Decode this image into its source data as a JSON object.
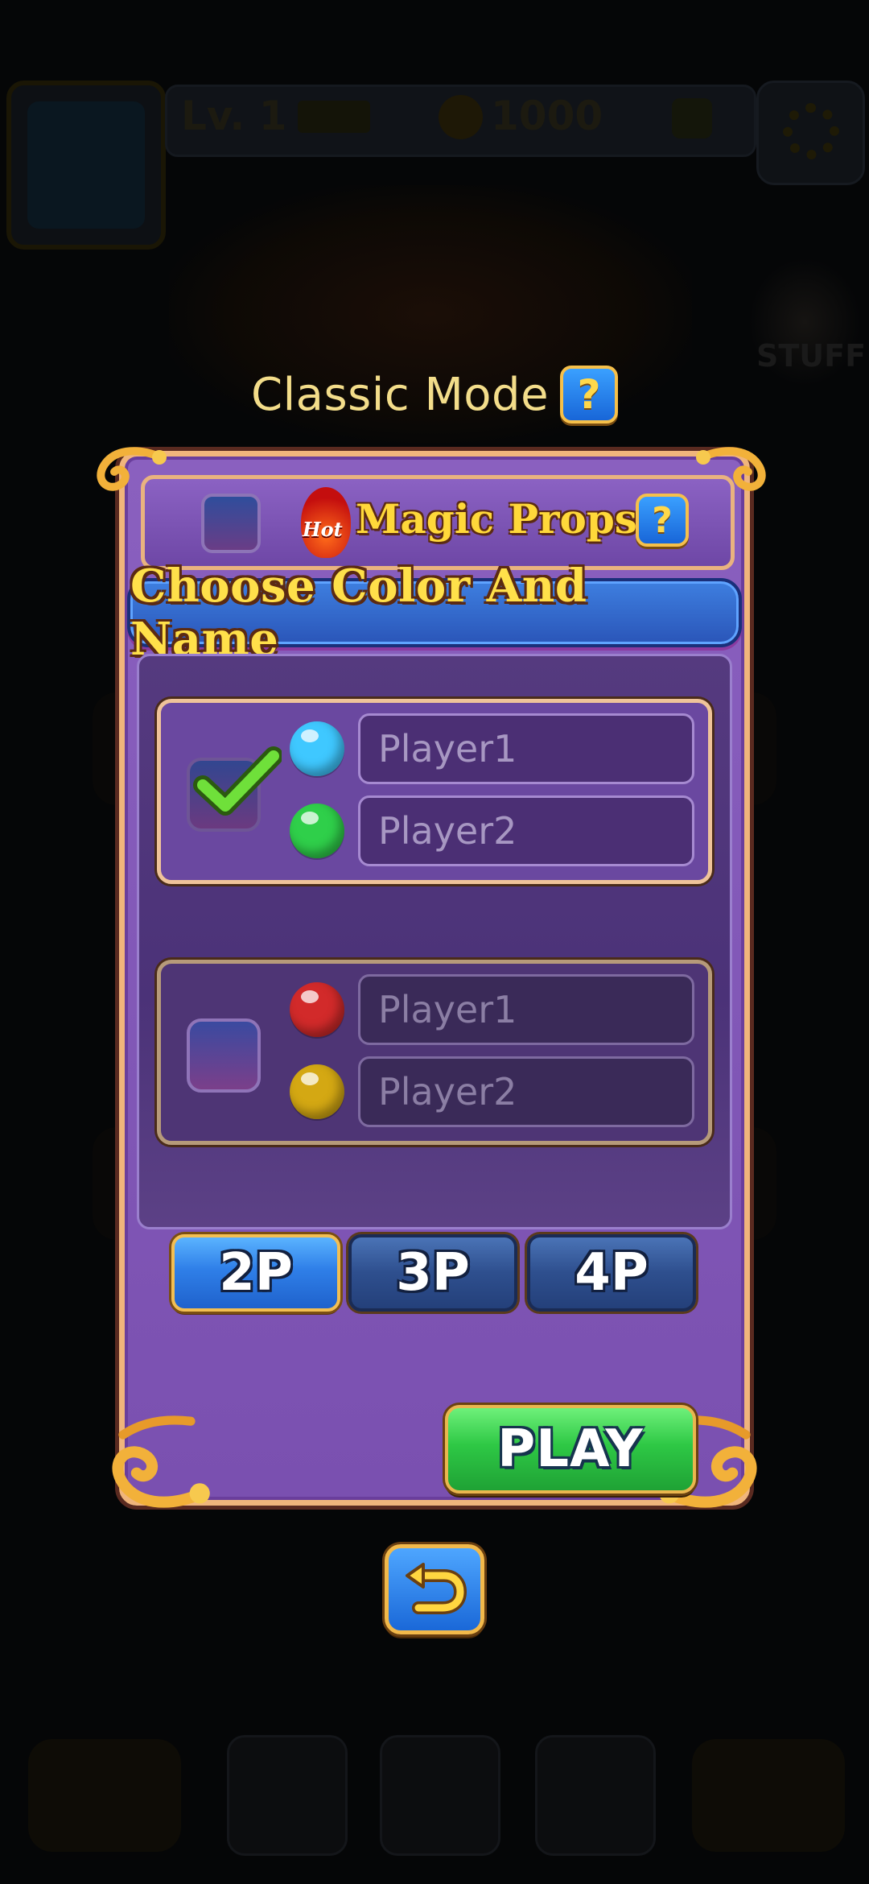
{
  "header": {
    "mode_title": "Classic Mode",
    "help_label": "?"
  },
  "background": {
    "level": "Lv. 1",
    "coins": "1000",
    "stuff_label": "STUFF"
  },
  "magic_props": {
    "hot_badge": "Hot",
    "label": "Magic Props",
    "help_label": "?",
    "checked": false
  },
  "choose": {
    "banner": "Choose Color And Name"
  },
  "teams": [
    {
      "selected": true,
      "players": [
        {
          "color": "#3fc8ff",
          "placeholder": "Player1"
        },
        {
          "color": "#2fcf4a",
          "placeholder": "Player2"
        }
      ]
    },
    {
      "selected": false,
      "players": [
        {
          "color": "#d22a2a",
          "placeholder": "Player1"
        },
        {
          "color": "#d4a813",
          "placeholder": "Player2"
        }
      ]
    }
  ],
  "player_count": {
    "options": [
      "2P",
      "3P",
      "4P"
    ],
    "selected": "2P"
  },
  "actions": {
    "play_label": "PLAY",
    "back_icon": "undo-arrow-icon"
  },
  "colors": {
    "accent_gold": "#ffd83a",
    "panel_purple": "#7a50b0",
    "play_green": "#2ec845",
    "button_blue": "#2f7fe8"
  }
}
